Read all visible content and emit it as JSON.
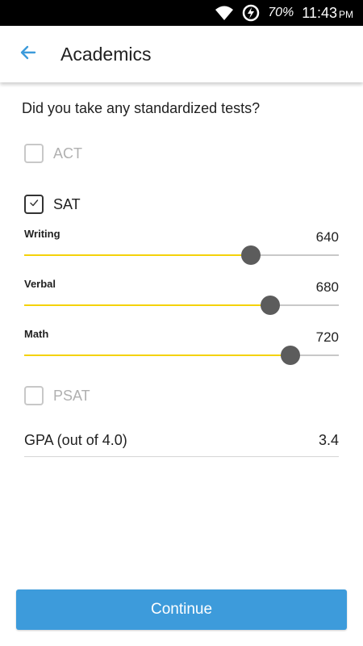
{
  "status_bar": {
    "battery_percent": "70%",
    "time": "11:43",
    "ampm": "PM",
    "icons": [
      "wifi-icon",
      "battery-charging-icon"
    ]
  },
  "app_bar": {
    "title": "Academics",
    "back_icon": "arrow-left-icon"
  },
  "question": "Did you take any standardized tests?",
  "tests": [
    {
      "label": "ACT",
      "checked": false
    },
    {
      "label": "SAT",
      "checked": true
    },
    {
      "label": "PSAT",
      "checked": false
    }
  ],
  "sat_scores": [
    {
      "label": "Writing",
      "value": "640",
      "fraction": 0.721
    },
    {
      "label": "Verbal",
      "value": "680",
      "fraction": 0.782
    },
    {
      "label": "Math",
      "value": "720",
      "fraction": 0.846
    }
  ],
  "gpa": {
    "label": "GPA (out of 4.0)",
    "value": "3.4"
  },
  "continue_label": "Continue",
  "colors": {
    "accent": "#3d9bdb",
    "slider_fill": "#f4d20a",
    "slider_thumb": "#5c5c5c",
    "back_arrow": "#3d9bdb"
  }
}
